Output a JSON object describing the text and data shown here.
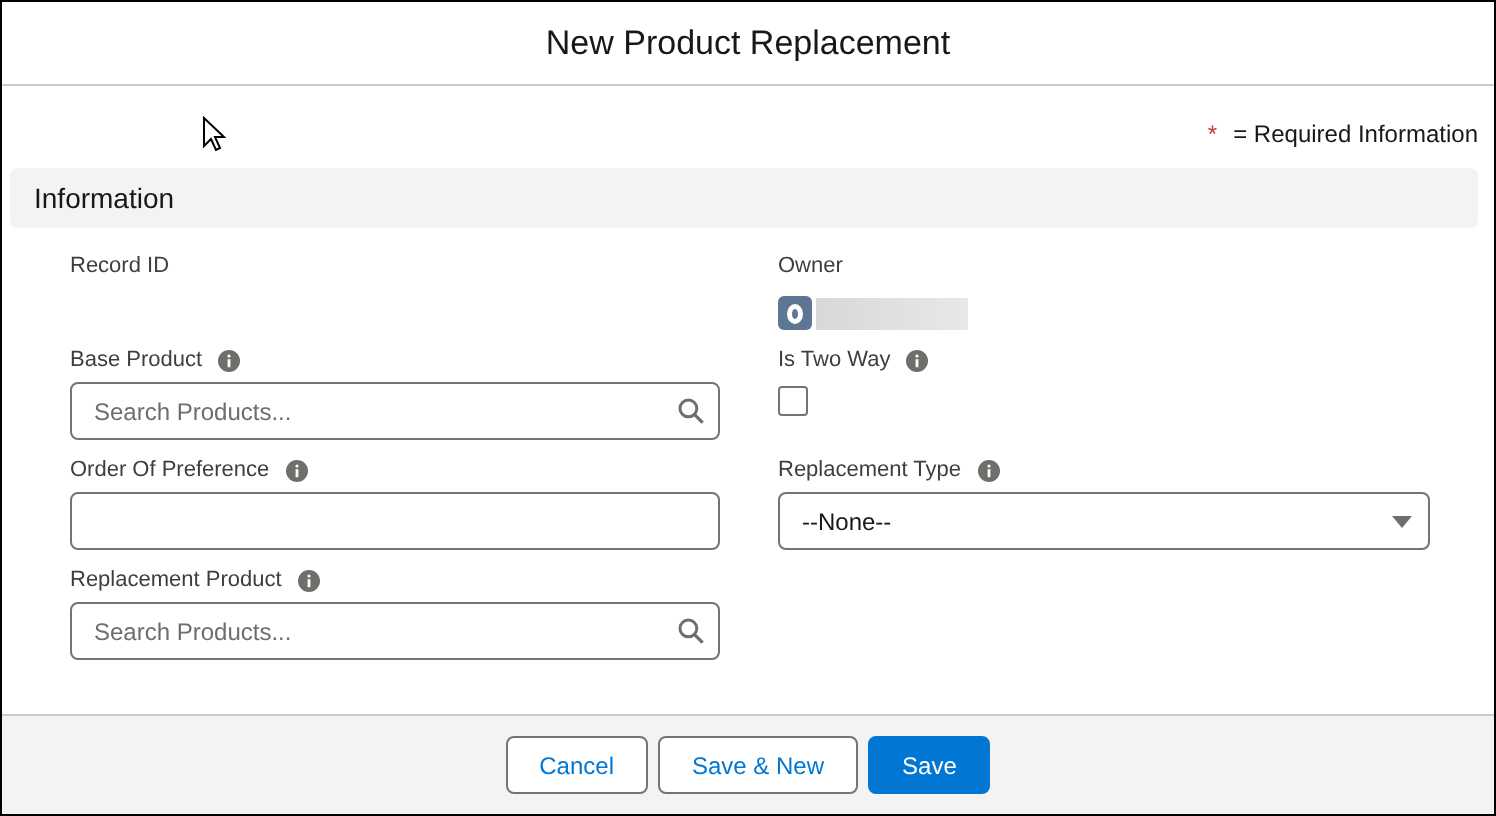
{
  "window": {
    "title": "New Product Replacement"
  },
  "required_note": {
    "mark": "*",
    "text": "= Required Information"
  },
  "section": {
    "title": "Information"
  },
  "fields": [
    {
      "kind": "readonly",
      "label": "Record ID",
      "info": false
    },
    {
      "kind": "owner",
      "label": "Owner",
      "info": false
    },
    {
      "kind": "lookup",
      "label": "Base Product",
      "info": true,
      "placeholder": "Search Products..."
    },
    {
      "kind": "checkbox",
      "label": "Is Two Way",
      "info": true,
      "checked": false
    },
    {
      "kind": "input",
      "label": "Order Of Preference",
      "info": true
    },
    {
      "kind": "picklist",
      "label": "Replacement Type",
      "info": true,
      "value": "--None--"
    },
    {
      "kind": "lookup",
      "label": "Replacement Product",
      "info": true,
      "placeholder": "Search Products..."
    }
  ],
  "buttons": [
    {
      "kind": "neutral",
      "label": "Cancel"
    },
    {
      "kind": "neutral",
      "label": "Save & New"
    },
    {
      "kind": "brand",
      "label": "Save"
    }
  ]
}
